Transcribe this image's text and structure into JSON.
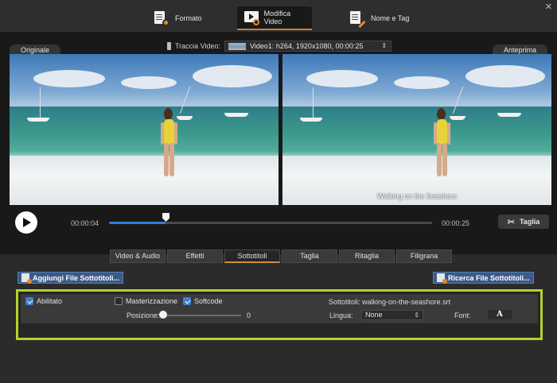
{
  "top_tabs": [
    {
      "label": "Formato",
      "icon": "document-gear-icon"
    },
    {
      "label": "Modifica Video",
      "icon": "clapper-scissors-icon",
      "active": true
    },
    {
      "label": "Nome e Tag",
      "icon": "document-pencil-icon"
    }
  ],
  "preview": {
    "original_label": "Originale",
    "preview_label": "Anteprima",
    "track_label": "Traccia Video:",
    "track_value": "Video1: h264, 1920x1080, 00:00:25",
    "caption": "Walking on the Seashore"
  },
  "playback": {
    "current_time": "00:00:04",
    "total_time": "00:00:25",
    "progress_fraction": 0.175,
    "cut_label": "Taglia"
  },
  "edit_tabs": [
    "Video & Audio",
    "Effetti",
    "Sottotitoli",
    "Taglia",
    "Ritaglia",
    "Filigrana"
  ],
  "active_edit_tab": "Sottotitoli",
  "subtitles": {
    "add_button": "Aggiungi File Sottotitoli...",
    "search_button": "Ricerca File Sottotitoli...",
    "enabled_label": "Abilitato",
    "enabled": true,
    "burn_label": "Masterizzazione",
    "burn": false,
    "softcode_label": "Softcode",
    "softcode": true,
    "file_text": "Sottotitoli: walking-on-the-seashore.srt",
    "position_label": "Posizione:",
    "position_value": "0",
    "language_label": "Lingua:",
    "language_value": "None",
    "font_label": "Font:",
    "font_glyph": "A"
  },
  "colors": {
    "accent_orange": "#e8872b",
    "highlight_green": "#b5d22c",
    "seek_blue": "#2f7fd8"
  }
}
